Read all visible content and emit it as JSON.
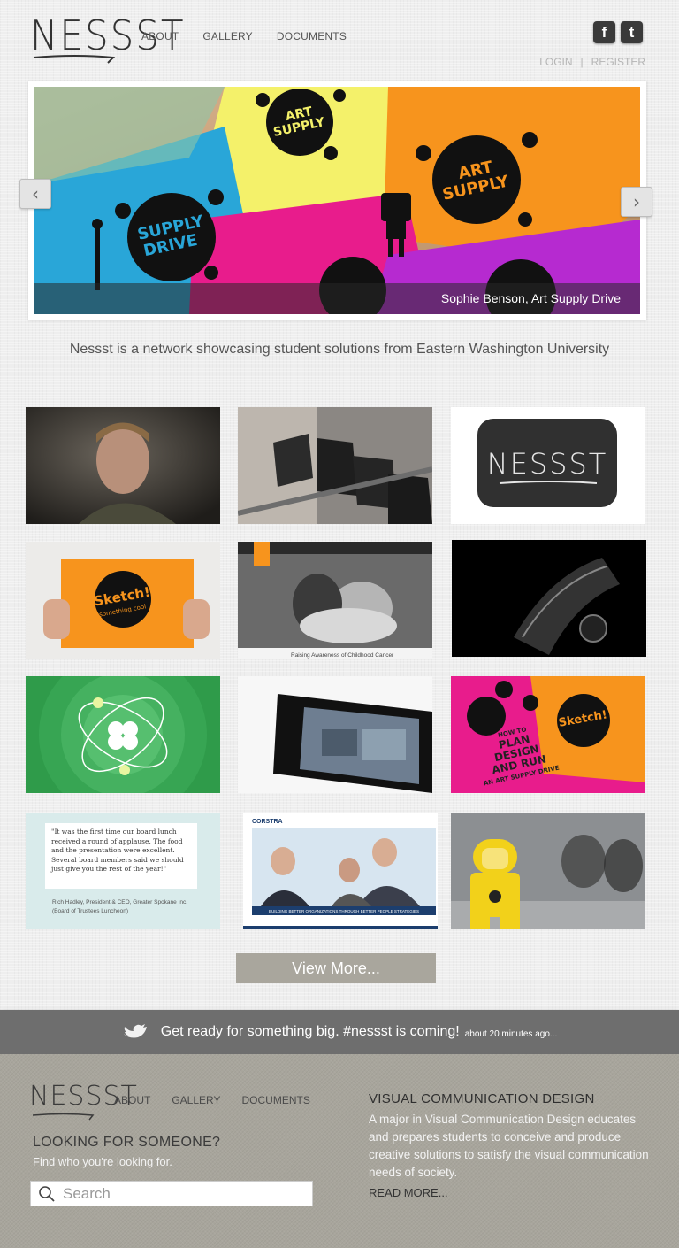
{
  "header": {
    "logo_text": "NESSST",
    "nav": [
      "ABOUT",
      "GALLERY",
      "DOCUMENTS"
    ],
    "social": {
      "facebook": "f",
      "twitter": "t"
    },
    "login_label": "LOGIN",
    "separator": "|",
    "register_label": "REGISTER"
  },
  "slider": {
    "caption": "Sophie Benson, Art Supply Drive",
    "prev_icon": "chevron-left-icon",
    "next_icon": "chevron-right-icon",
    "poster_text": [
      "ART",
      "SUPPLY",
      "DRIVE"
    ]
  },
  "tagline": "Nessst is a network showcasing student solutions from Eastern Washington University",
  "gallery": {
    "logo_tile_text": "NESSST",
    "sketch_text": "Sketch!",
    "sketch_sub": "something cool",
    "cancer_caption": "Raising Awareness of Childhood Cancer",
    "plan_lines": [
      "HOW TO",
      "PLAN",
      "DESIGN",
      "AND RUN",
      "AN ART SUPPLY DRIVE"
    ],
    "quote": "\"It was the first time our board lunch received a round of applause. The food and the presentation were excellent. Several board members said we should just give you the rest of the year!\"",
    "quote_author": "Rich Hadley, President & CEO, Greater Spokane Inc.",
    "quote_event": "(Board of Trustees Luncheon)",
    "corpus_brand": "CORSTRA",
    "corpus_banner": "BUILDING BETTER ORGANIZATIONS THROUGH BETTER PEOPLE STRATEGIES"
  },
  "view_more_label": "View More...",
  "tweet": {
    "message": "Get ready for something big. #nessst is coming!",
    "time": "about 20 minutes ago..."
  },
  "footer": {
    "logo_text": "NESSST",
    "nav": [
      "ABOUT",
      "GALLERY",
      "DOCUMENTS"
    ],
    "heading": "LOOKING FOR SOMEONE?",
    "subheading": "Find who you're looking for.",
    "search_placeholder": "Search",
    "vcd_title": "VISUAL COMMUNICATION DESIGN",
    "vcd_body": "A major in Visual Communication Design educates and prepares students to conceive and produce creative solutions to satisfy the visual communication needs of society.",
    "read_more": "READ MORE..."
  },
  "colors": {
    "background": "#eeeeee",
    "footer_bg": "#a8a59c",
    "tweet_bar": "#6e6e6e",
    "view_more": "#a9a69d",
    "magenta": "#e81c8c",
    "orange": "#f7941d",
    "yellow": "#f4f16a",
    "cyan": "#29a6d8",
    "green": "#2fae5a"
  }
}
